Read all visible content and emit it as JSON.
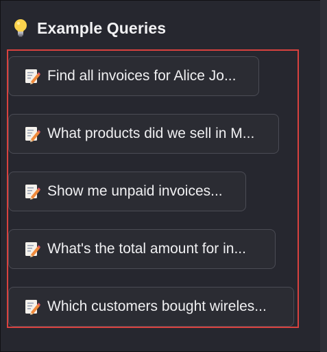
{
  "header": {
    "icon": "light-bulb-icon",
    "title": "Example Queries"
  },
  "queries": [
    {
      "icon": "memo-icon",
      "label": "Find all invoices for Alice Jo..."
    },
    {
      "icon": "memo-icon",
      "label": "What products did we sell in M..."
    },
    {
      "icon": "memo-icon",
      "label": "Show me unpaid invoices..."
    },
    {
      "icon": "memo-icon",
      "label": "What's the total amount for in..."
    },
    {
      "icon": "memo-icon",
      "label": "Which customers bought wireles..."
    }
  ],
  "colors": {
    "background": "#26272f",
    "button_bg": "#2b2c33",
    "button_border": "#4b4c55",
    "text": "#f0f0f2",
    "highlight": "#d9423f"
  }
}
